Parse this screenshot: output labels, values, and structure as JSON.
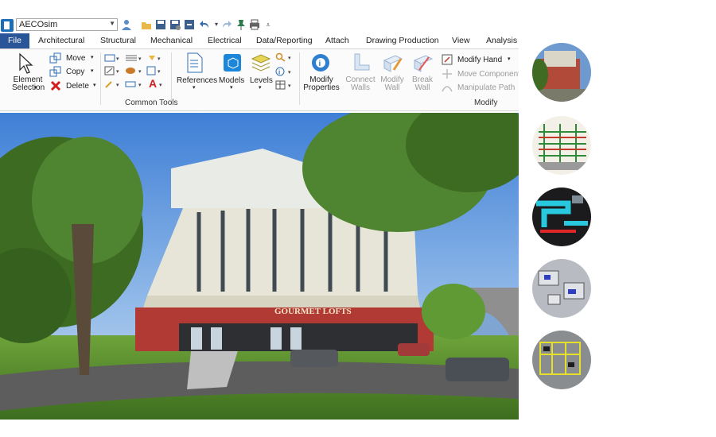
{
  "workspace": {
    "selected": "AECOsim"
  },
  "tabs": [
    "File",
    "Architectural",
    "Structural",
    "Mechanical",
    "Electrical",
    "Data/Reporting",
    "Attach",
    "Drawing Production",
    "View",
    "Analysis"
  ],
  "ribbon": {
    "element_selection": "Element Selection",
    "move": "Move",
    "copy": "Copy",
    "delete": "Delete",
    "references": "References",
    "models": "Models",
    "levels": "Levels",
    "modify_properties": "Modify Properties",
    "connect_walls": "Connect Walls",
    "modify_wall": "Modify Wall",
    "break_wall": "Break Wall",
    "modify_hand": "Modify Hand",
    "move_component": "Move Component",
    "manipulate_path": "Manipulate Path",
    "group_common_tools": "Common Tools",
    "group_modify": "Modify"
  },
  "scene": {
    "sign": "GOURMET LOFTS"
  },
  "thumbnails": [
    "photo-render-view",
    "structural-frame-view",
    "mechanical-ducts-view",
    "interior-plan-view",
    "electrical-layout-view"
  ]
}
